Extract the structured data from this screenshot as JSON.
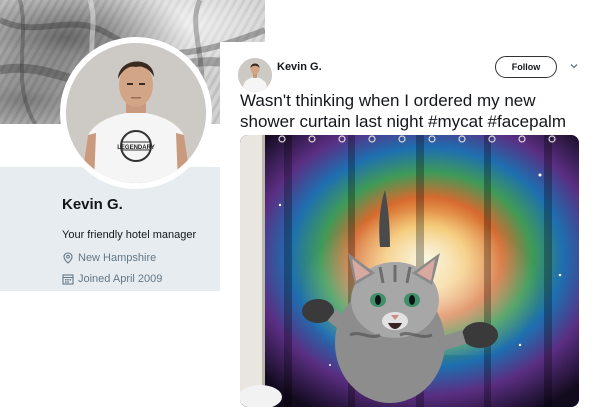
{
  "profile": {
    "name": "Kevin G.",
    "bio": "Your friendly hotel manager",
    "location": "New Hampshire",
    "joined": "Joined April 2009",
    "shirt_text": "LEGENDARY"
  },
  "tweet": {
    "author": "Kevin G.",
    "follow_label": "Follow",
    "text": "Wasn't thinking when I ordered my new shower curtain last night #mycat #facepalm"
  },
  "icons": {
    "location": "map-pin-icon",
    "joined": "calendar-icon",
    "menu": "chevron-down-icon"
  },
  "colors": {
    "panel_background": "#e6ecf0",
    "secondary_text": "#657786",
    "primary_text": "#14171a"
  }
}
